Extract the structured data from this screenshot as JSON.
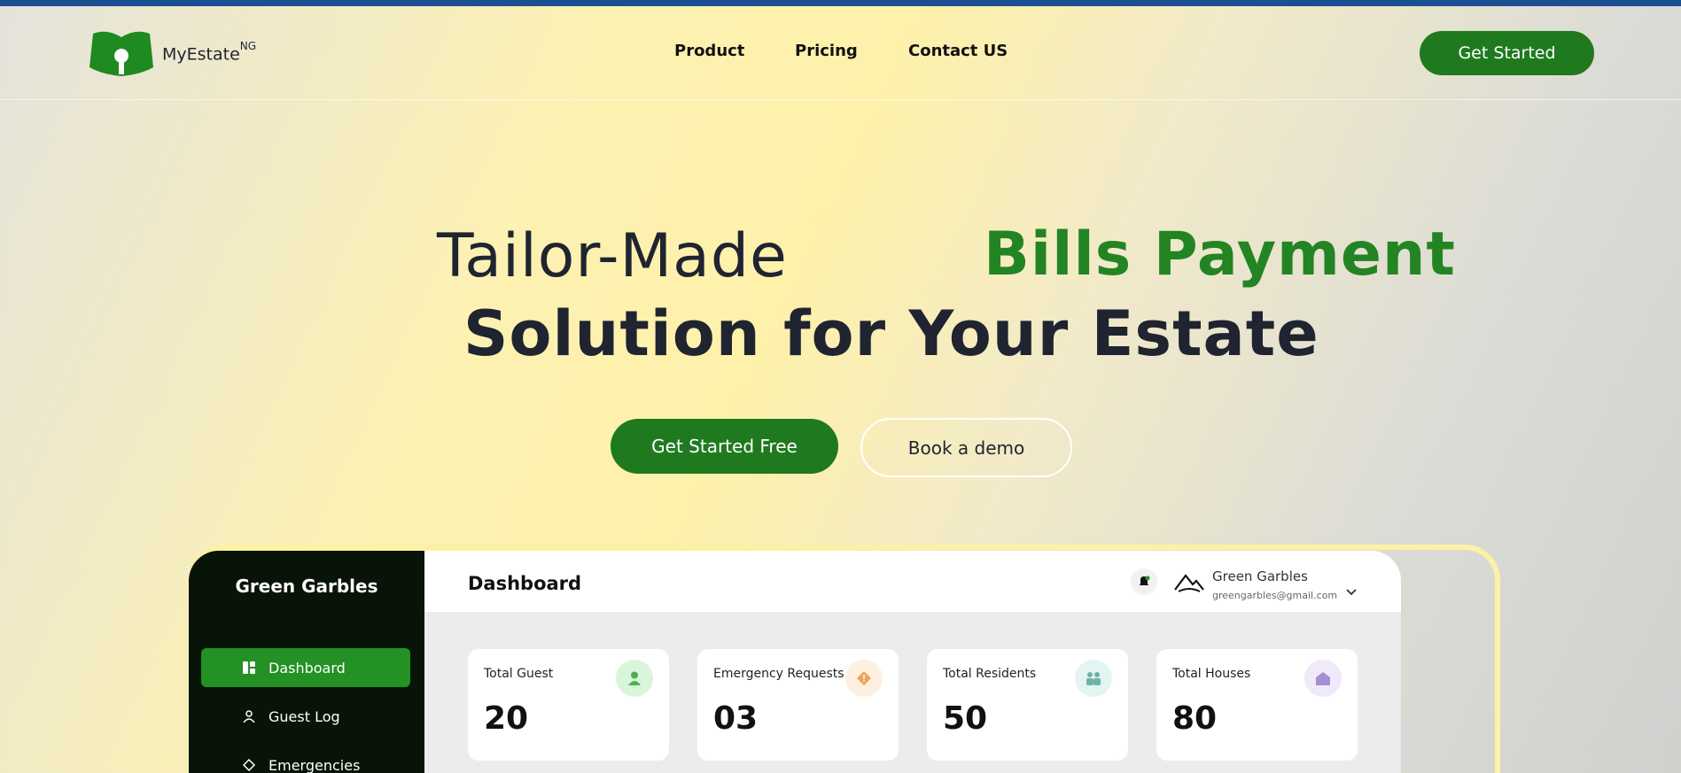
{
  "brand": {
    "name": "MyEstate",
    "superscript": "NG"
  },
  "nav": {
    "product": "Product",
    "pricing": "Pricing",
    "contact": "Contact US"
  },
  "header_cta": "Get Started",
  "hero": {
    "line1_regular": "Tailor-Made",
    "line1_accent": "Bills Payment",
    "line2": "Solution for Your Estate"
  },
  "cta": {
    "primary": "Get Started Free",
    "secondary": "Book a demo"
  },
  "colors": {
    "brand_green": "#1f7a1f",
    "accent_green": "#238423",
    "topbar_blue": "#1b4f92",
    "sidebar_dark": "#091409"
  },
  "dashboard": {
    "sidebar": {
      "brand": "Green Garbles",
      "items": [
        {
          "label": "Dashboard",
          "icon": "grid-icon",
          "active": true
        },
        {
          "label": "Guest Log",
          "icon": "user-icon",
          "active": false
        },
        {
          "label": "Emergencies",
          "icon": "diamond-alert-icon",
          "active": false
        }
      ]
    },
    "title": "Dashboard",
    "user": {
      "name": "Green Garbles",
      "email": "greengarbles@gmail.com"
    },
    "cards": [
      {
        "label": "Total Guest",
        "value": "20",
        "icon": "person-icon",
        "icon_bg": "#d9f5dc",
        "icon_color": "#4caf50"
      },
      {
        "label": "Emergency Requests",
        "value": "03",
        "icon": "warning-diamond-icon",
        "icon_bg": "#fdf0e2",
        "icon_color": "#f0a05a"
      },
      {
        "label": "Total Residents",
        "value": "50",
        "icon": "people-icon",
        "icon_bg": "#e4f4f3",
        "icon_color": "#6fb3a8"
      },
      {
        "label": "Total Houses",
        "value": "80",
        "icon": "house-icon",
        "icon_bg": "#efe9fa",
        "icon_color": "#a48fd6"
      }
    ]
  }
}
